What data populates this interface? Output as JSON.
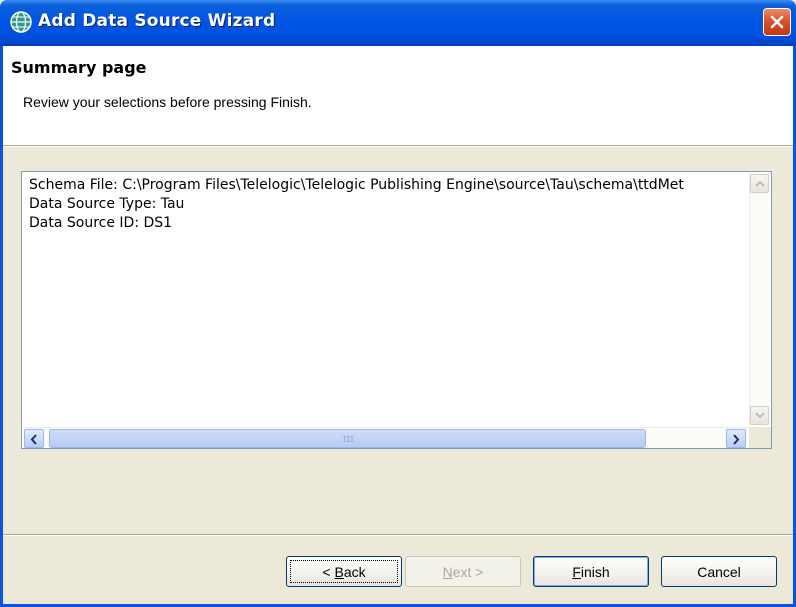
{
  "window": {
    "title": "Add Data Source Wizard",
    "icon": "globe-icon",
    "close_icon": "close-icon"
  },
  "header": {
    "title": "Summary page",
    "description": "Review your selections before pressing Finish."
  },
  "summary": {
    "lines": [
      "Schema File: C:\\Program Files\\Telelogic\\Telelogic Publishing Engine\\source\\Tau\\schema\\ttdMet",
      "Data Source Type: Tau",
      "Data Source ID: DS1"
    ],
    "hscroll_grip": "III"
  },
  "buttons": {
    "back": {
      "before": "< ",
      "mnemonic": "B",
      "after": "ack"
    },
    "next": {
      "mnemonic": "N",
      "after": "ext >"
    },
    "finish": {
      "mnemonic": "F",
      "after": "inish"
    },
    "cancel": {
      "label": "Cancel"
    }
  },
  "colors": {
    "title_bar": "#0054e3",
    "close_button": "#d9532c",
    "dialog_background": "#ece9d8",
    "scroll_thumb": "#c3d4f7"
  }
}
